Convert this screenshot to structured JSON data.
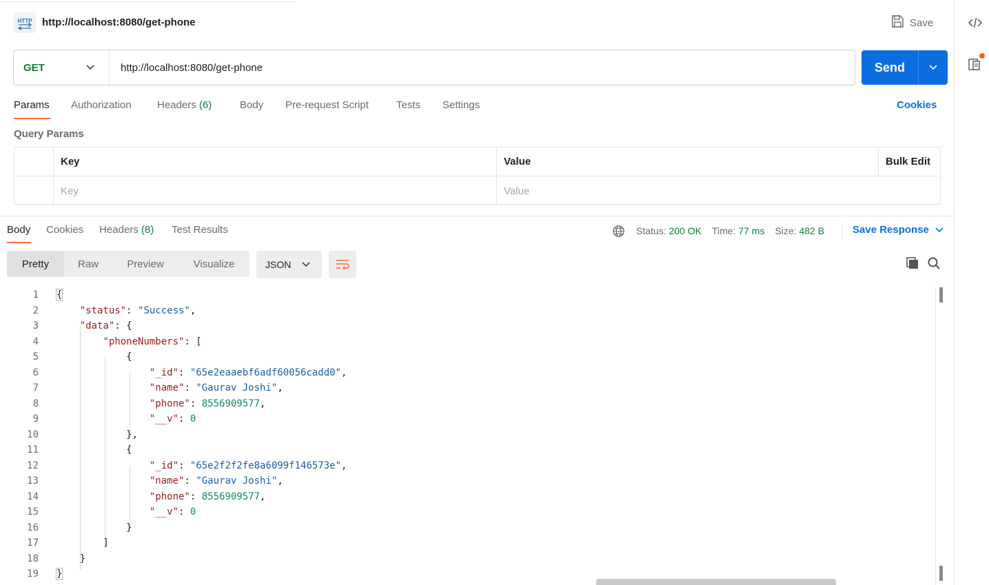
{
  "header": {
    "http_badge": "HTTP",
    "title": "http://localhost:8080/get-phone",
    "save_label": "Save"
  },
  "request": {
    "method": "GET",
    "url": "http://localhost:8080/get-phone",
    "send_label": "Send"
  },
  "request_tabs": {
    "params": "Params",
    "authorization": "Authorization",
    "headers": "Headers",
    "headers_count": "(6)",
    "body": "Body",
    "pre_request": "Pre-request Script",
    "tests": "Tests",
    "settings": "Settings",
    "cookies": "Cookies"
  },
  "query_params": {
    "title": "Query Params",
    "col_key": "Key",
    "col_value": "Value",
    "bulk_edit": "Bulk Edit",
    "key_placeholder": "Key",
    "value_placeholder": "Value"
  },
  "response_tabs": {
    "body": "Body",
    "cookies": "Cookies",
    "headers": "Headers",
    "headers_count": "(8)",
    "test_results": "Test Results"
  },
  "status": {
    "status_label": "Status:",
    "status_value": "200 OK",
    "time_label": "Time:",
    "time_value": "77 ms",
    "size_label": "Size:",
    "size_value": "482 B",
    "save_response": "Save Response"
  },
  "view": {
    "pretty": "Pretty",
    "raw": "Raw",
    "preview": "Preview",
    "visualize": "Visualize",
    "format": "JSON"
  },
  "code_lines": [
    {
      "n": "1"
    },
    {
      "n": "2",
      "key": "\"status\"",
      "str": "\"Success\""
    },
    {
      "n": "3",
      "key": "\"data\""
    },
    {
      "n": "4",
      "key": "\"phoneNumbers\""
    },
    {
      "n": "5"
    },
    {
      "n": "6",
      "key": "\"_id\"",
      "str": "\"65e2eaaebf6adf60056cadd0\""
    },
    {
      "n": "7",
      "key": "\"name\"",
      "str": "\"Gaurav Joshi\""
    },
    {
      "n": "8",
      "key": "\"phone\"",
      "num": "8556909577"
    },
    {
      "n": "9",
      "key": "\"__v\"",
      "num": "0"
    },
    {
      "n": "10"
    },
    {
      "n": "11"
    },
    {
      "n": "12",
      "key": "\"_id\"",
      "str": "\"65e2f2f2fe8a6099f146573e\""
    },
    {
      "n": "13",
      "key": "\"name\"",
      "str": "\"Gaurav Joshi\""
    },
    {
      "n": "14",
      "key": "\"phone\"",
      "num": "8556909577"
    },
    {
      "n": "15",
      "key": "\"__v\"",
      "num": "0"
    },
    {
      "n": "16"
    },
    {
      "n": "17"
    },
    {
      "n": "18"
    },
    {
      "n": "19"
    }
  ],
  "icons": {
    "http": "http-icon",
    "save": "floppy-disk-icon",
    "method_caret": "chevron-down-icon",
    "send_caret": "chevron-down-icon",
    "globe": "globe-icon",
    "save_response_caret": "chevron-down-icon",
    "wrap": "wrap-lines-icon",
    "copy": "copy-icon",
    "search": "search-icon",
    "code": "code-icon",
    "docs": "documentation-icon"
  },
  "colors": {
    "accent_orange": "#ff6c37",
    "primary_blue": "#0b6ee0",
    "method_green": "#0c7d3a",
    "json_key": "#9b1b1b",
    "json_string": "#1b5ea6",
    "json_number": "#0f8a5f"
  }
}
